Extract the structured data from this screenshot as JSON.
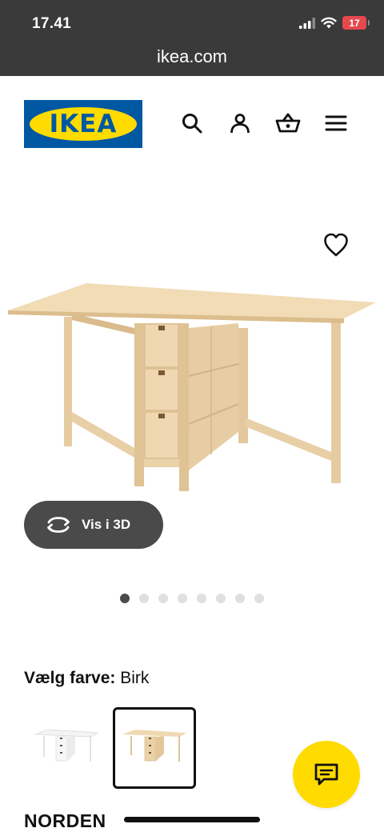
{
  "status_bar": {
    "time": "17.41",
    "battery_level": "17",
    "icons": [
      "signal-icon",
      "wifi-icon",
      "battery-icon"
    ],
    "battery_color": "#e5484d"
  },
  "browser": {
    "url": "ikea.com"
  },
  "header": {
    "logo_text": "IKEA",
    "brand_colors": {
      "blue": "#0058a3",
      "yellow": "#ffdb00"
    },
    "nav_icons": [
      "search-icon",
      "user-icon",
      "basket-icon",
      "menu-icon"
    ]
  },
  "gallery": {
    "favorite_icon": "heart-icon",
    "view_3d_label": "Vis i 3D",
    "view_3d_icon": "rotate-icon",
    "page_count": 8,
    "active_page": 1
  },
  "color_selector": {
    "label": "Vælg farve:",
    "selected_value": "Birk",
    "options": [
      {
        "name": "white",
        "selected": false
      },
      {
        "name": "birch",
        "selected": true
      }
    ]
  },
  "product": {
    "name": "NORDEN"
  },
  "chat": {
    "icon": "chat-icon"
  }
}
